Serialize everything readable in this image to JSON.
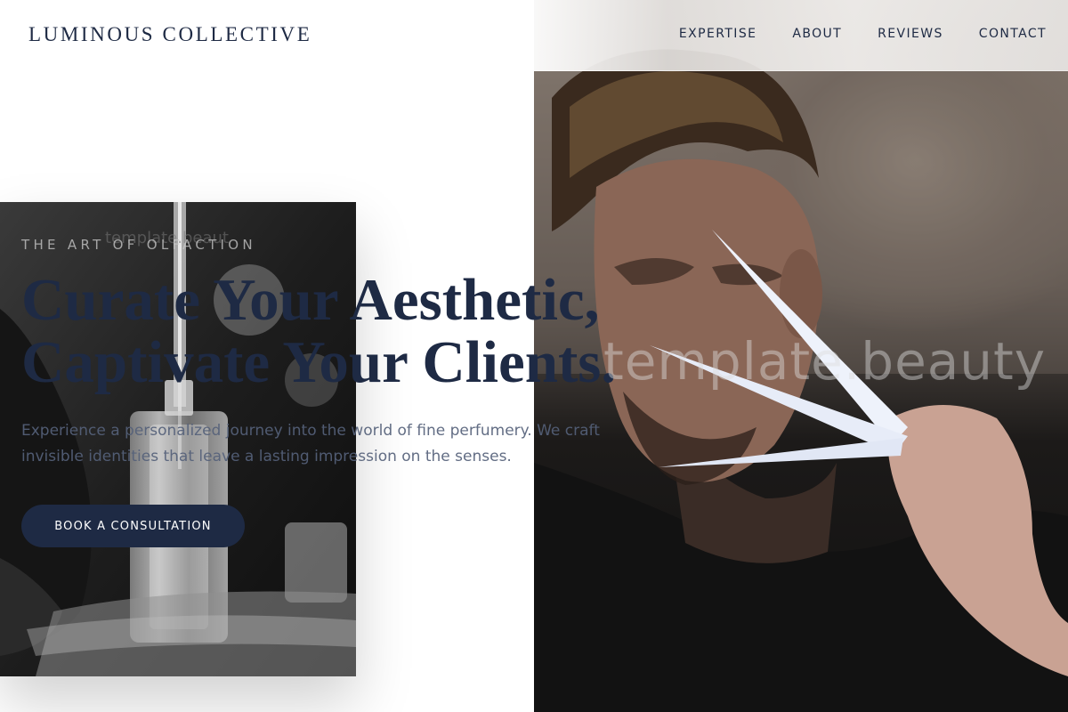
{
  "header": {
    "brand": "LUMINOUS COLLECTIVE",
    "nav": [
      {
        "label": "EXPERTISE"
      },
      {
        "label": "ABOUT"
      },
      {
        "label": "REVIEWS"
      },
      {
        "label": "CONTACT"
      }
    ]
  },
  "hero": {
    "eyebrow": "THE ART OF OLFACTION",
    "headline_line1": "Curate Your Aesthetic,",
    "headline_line2": "Captivate Your Clients.",
    "description": "Experience a personalized journey into the world of fine perfumery. We craft invisible identities that leave a lasting impression on the senses.",
    "cta_label": "BOOK A CONSULTATION",
    "watermark_large": "template.beauty",
    "watermark_small": "template.beaut"
  },
  "colors": {
    "primary": "#1e2a44",
    "text_muted": "#55617a",
    "background": "#ffffff"
  }
}
